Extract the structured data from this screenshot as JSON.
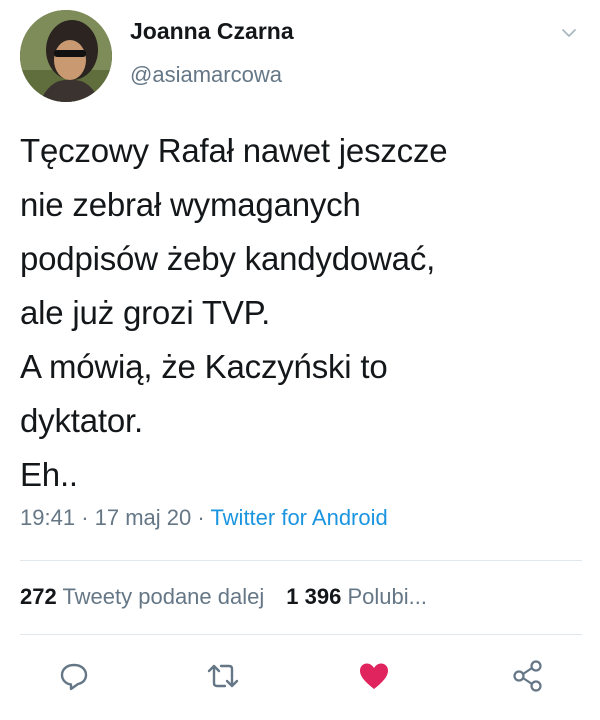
{
  "author": {
    "name": "Joanna Czarna",
    "handle": "@asiamarcowa"
  },
  "tweet": {
    "text": "Tęczowy Rafał nawet jeszcze\nnie zebrał wymaganych\npodpisów żeby kandydować,\nale już grozi TVP.\nA mówią, że Kaczyński to\ndyktator.\nEh..",
    "time": "19:41",
    "date": "17 maj 20",
    "separator": "·",
    "source": "Twitter for Android"
  },
  "stats": {
    "retweets_count": "272",
    "retweets_label": "Tweety podane dalej",
    "likes_count": "1 396",
    "likes_label": "Polubi..."
  },
  "icons": {
    "menu": "chevron-down-icon",
    "reply": "reply-icon",
    "retweet": "retweet-icon",
    "like": "heart-icon",
    "share": "share-icon"
  },
  "colors": {
    "like_active": "#e0245e",
    "secondary_text": "#657786",
    "link": "#1b95e0"
  }
}
